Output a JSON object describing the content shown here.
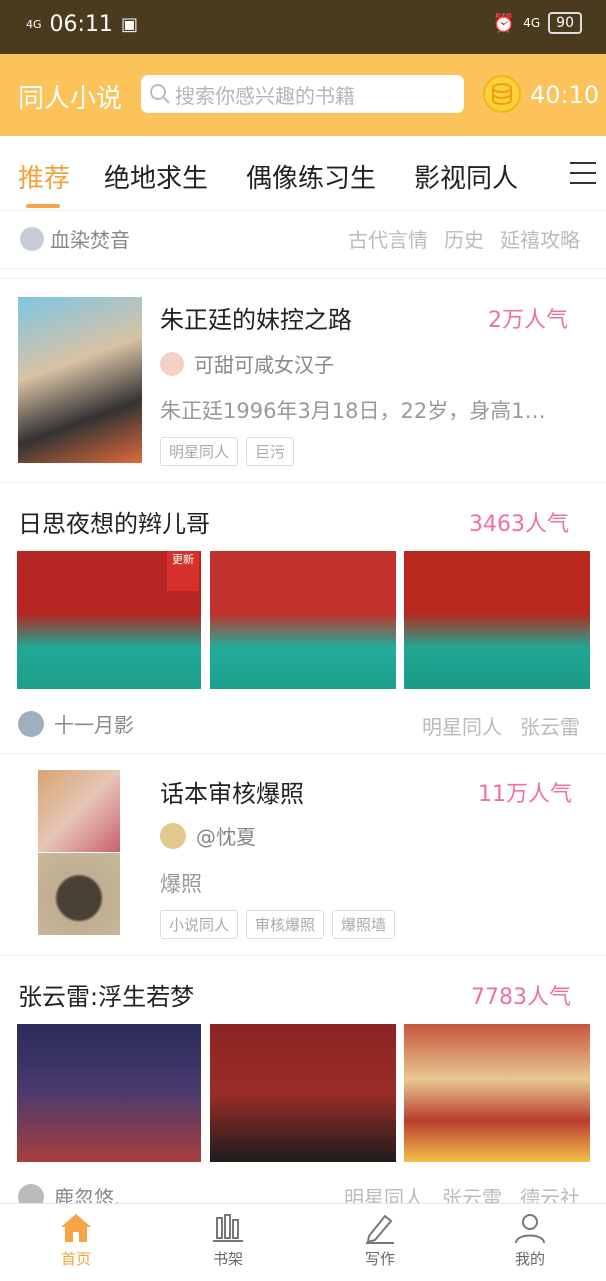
{
  "statusbar": {
    "signal": "4G",
    "time": "06:11",
    "battery": "90",
    "right_net": "4G"
  },
  "header": {
    "title": "同人小说",
    "search_placeholder": "搜索你感兴趣的书籍",
    "coins": "40:10"
  },
  "tabs": [
    {
      "label": "推荐"
    },
    {
      "label": "绝地求生"
    },
    {
      "label": "偶像练习生"
    },
    {
      "label": "影视同人"
    },
    {
      "label": "E"
    }
  ],
  "subbar": {
    "author": "血染焚音",
    "tags": [
      "古代言情",
      "历史",
      "延禧攻略"
    ]
  },
  "cards": [
    {
      "title": "朱正廷的妹控之路",
      "popularity": "2万人气",
      "author": "可甜可咸女汉子",
      "desc": "朱正廷1996年3月18日，22岁，身高1…",
      "tags": [
        "明星同人",
        "巨污"
      ]
    },
    {
      "title": "日思夜想的辫儿哥",
      "popularity": "3463人气",
      "badge": "更新",
      "author": "十一月影",
      "tags": [
        "明星同人",
        "张云雷"
      ]
    },
    {
      "title": "话本审核爆照",
      "popularity": "11万人气",
      "author": "@忱夏",
      "desc": "爆照",
      "tags": [
        "小说同人",
        "审核爆照",
        "爆照墙"
      ]
    },
    {
      "title": "张云雷:浮生若梦",
      "popularity": "7783人气",
      "author": "鹿忽悠.",
      "tags": [
        "明星同人",
        "张云雷",
        "德云社"
      ]
    }
  ],
  "nav": [
    {
      "label": "首页",
      "icon": "home-icon"
    },
    {
      "label": "书架",
      "icon": "bookshelf-icon"
    },
    {
      "label": "写作",
      "icon": "pen-icon"
    },
    {
      "label": "我的",
      "icon": "user-icon"
    }
  ],
  "colors": {
    "accent": "#fcc35a",
    "active_tab": "#f1a33c",
    "popularity": "#ef70a6",
    "statusbar": "#4a3b1f"
  }
}
